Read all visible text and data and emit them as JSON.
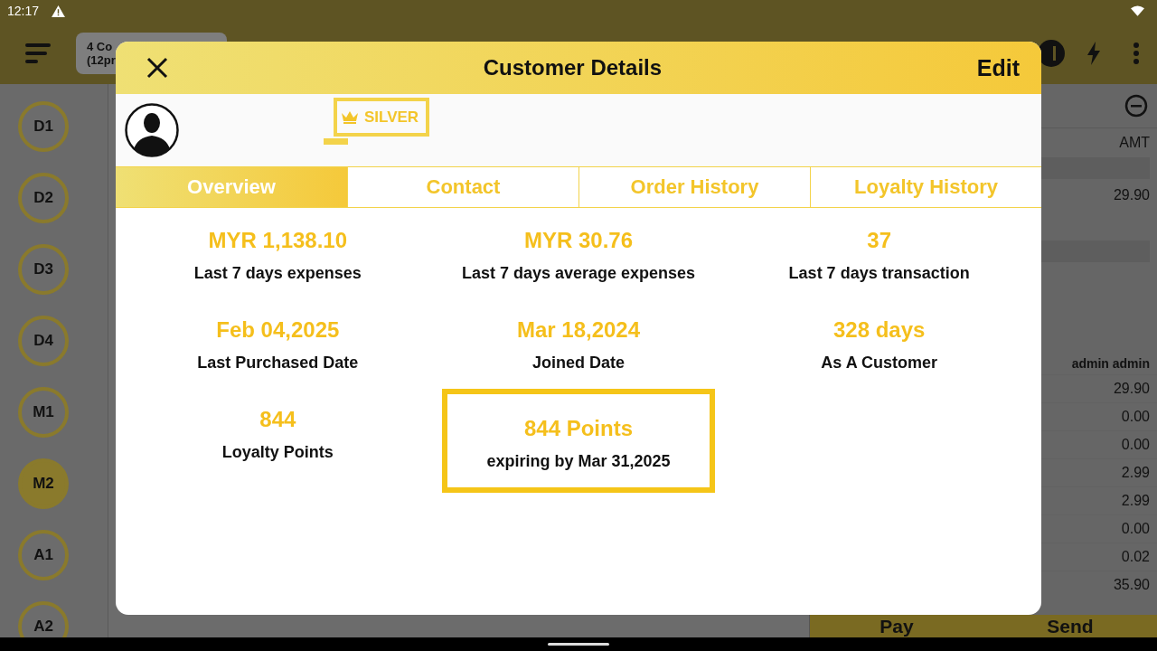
{
  "status_bar": {
    "time": "12:17"
  },
  "top_bar": {
    "order_chip": [
      "4 Co",
      "(12pr"
    ]
  },
  "tables": [
    {
      "label": "D1",
      "selected": false
    },
    {
      "label": "D2",
      "selected": false
    },
    {
      "label": "D3",
      "selected": false
    },
    {
      "label": "D4",
      "selected": false
    },
    {
      "label": "M1",
      "selected": false
    },
    {
      "label": "M2",
      "selected": true
    },
    {
      "label": "A1",
      "selected": false
    },
    {
      "label": "A2",
      "selected": false
    }
  ],
  "order_panel": {
    "column_header": "AMT",
    "first_amount": "29.90",
    "server": "admin admin",
    "amounts": [
      "29.90",
      "0.00",
      "0.00",
      "2.99",
      "2.99",
      "0.00",
      "0.02",
      "35.90"
    ],
    "buttons": [
      "Pay",
      "Send"
    ]
  },
  "dialog": {
    "title": "Customer Details",
    "edit": "Edit",
    "tier": "SILVER",
    "tabs": [
      {
        "label": "Overview",
        "selected": true
      },
      {
        "label": "Contact",
        "selected": false
      },
      {
        "label": "Order History",
        "selected": false
      },
      {
        "label": "Loyalty History",
        "selected": false
      }
    ],
    "stats": [
      {
        "value": "MYR 1,138.10",
        "label": "Last 7 days expenses",
        "highlighted": false
      },
      {
        "value": "MYR 30.76",
        "label": "Last 7 days average expenses",
        "highlighted": false
      },
      {
        "value": "37",
        "label": "Last 7 days transaction",
        "highlighted": false
      },
      {
        "value": "Feb 04,2025",
        "label": "Last Purchased Date",
        "highlighted": false
      },
      {
        "value": "Mar 18,2024",
        "label": "Joined Date",
        "highlighted": false
      },
      {
        "value": "328 days",
        "label": "As A Customer",
        "highlighted": false
      },
      {
        "value": "844",
        "label": "Loyalty Points",
        "highlighted": false
      },
      {
        "value": "844 Points",
        "label": "expiring by Mar 31,2025",
        "highlighted": true
      }
    ]
  }
}
